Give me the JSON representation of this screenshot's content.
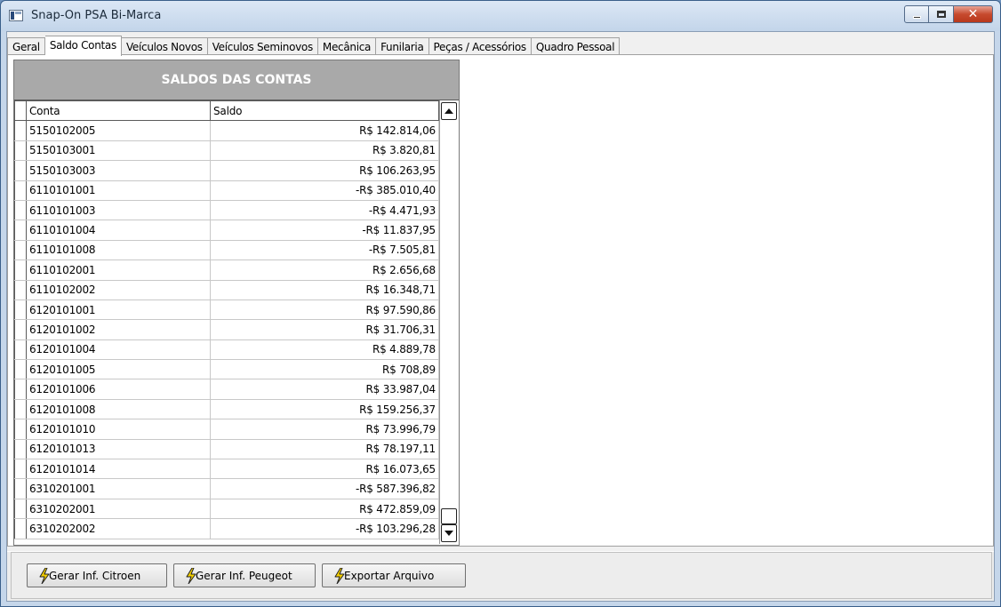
{
  "window": {
    "title": "Snap-On PSA Bi-Marca",
    "minimize_glyph": "",
    "maximize_glyph": "",
    "close_glyph": "✕"
  },
  "tabs": [
    {
      "label": "Geral",
      "active": false
    },
    {
      "label": "Saldo Contas",
      "active": true
    },
    {
      "label": "Veículos Novos",
      "active": false
    },
    {
      "label": "Veículos Seminovos",
      "active": false
    },
    {
      "label": "Mecânica",
      "active": false
    },
    {
      "label": "Funilaria",
      "active": false
    },
    {
      "label": "Peças / Acessórios",
      "active": false
    },
    {
      "label": "Quadro Pessoal",
      "active": false
    }
  ],
  "grid": {
    "title": "SALDOS DAS CONTAS",
    "columns": [
      "Conta",
      "Saldo"
    ],
    "rows": [
      [
        "5150102005",
        "R$ 142.814,06"
      ],
      [
        "5150103001",
        "R$ 3.820,81"
      ],
      [
        "5150103003",
        "R$ 106.263,95"
      ],
      [
        "6110101001",
        "-R$ 385.010,40"
      ],
      [
        "6110101003",
        "-R$ 4.471,93"
      ],
      [
        "6110101004",
        "-R$ 11.837,95"
      ],
      [
        "6110101008",
        "-R$ 7.505,81"
      ],
      [
        "6110102001",
        "R$ 2.656,68"
      ],
      [
        "6110102002",
        "R$ 16.348,71"
      ],
      [
        "6120101001",
        "R$ 97.590,86"
      ],
      [
        "6120101002",
        "R$ 31.706,31"
      ],
      [
        "6120101004",
        "R$ 4.889,78"
      ],
      [
        "6120101005",
        "R$ 708,89"
      ],
      [
        "6120101006",
        "R$ 33.987,04"
      ],
      [
        "6120101008",
        "R$ 159.256,37"
      ],
      [
        "6120101010",
        "R$ 73.996,79"
      ],
      [
        "6120101013",
        "R$ 78.197,11"
      ],
      [
        "6120101014",
        "R$ 16.073,65"
      ],
      [
        "6310201001",
        "-R$ 587.396,82"
      ],
      [
        "6310202001",
        "R$ 472.859,09"
      ],
      [
        "6310202002",
        "-R$ 103.296,28"
      ]
    ]
  },
  "buttons": [
    {
      "label": "Gerar Inf. Citroen",
      "icon": "lightning-icon"
    },
    {
      "label": "Gerar Inf. Peugeot",
      "icon": "lightning-icon"
    },
    {
      "label": "Exportar Arquivo",
      "icon": "lightning-icon"
    }
  ],
  "colors": {
    "grid_header_bg": "#a9a9a9",
    "close_button": "#c74a2e",
    "lightning": "#f5d000"
  }
}
